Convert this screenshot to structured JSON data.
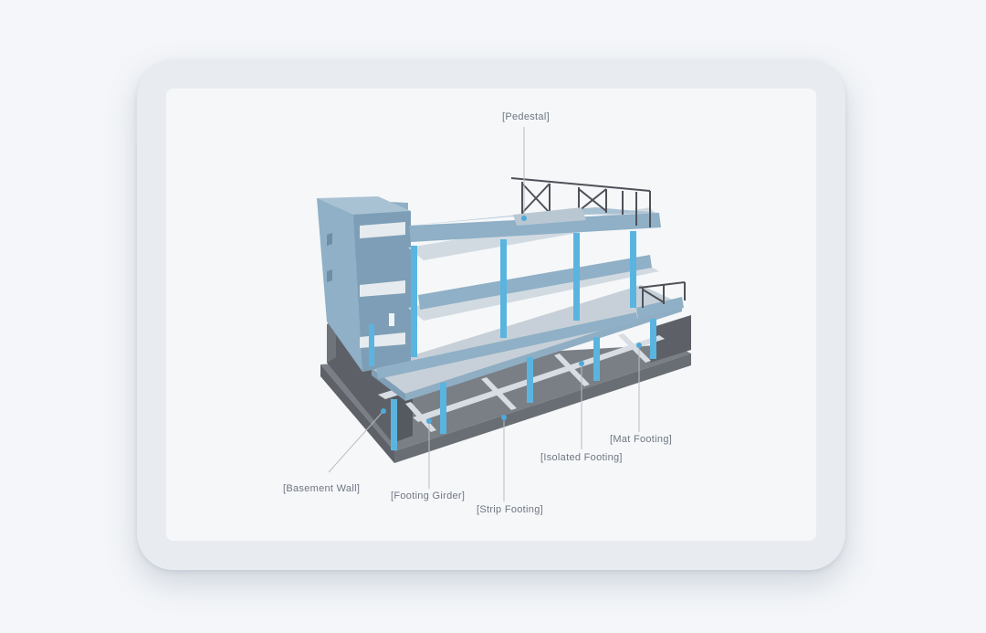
{
  "diagram": {
    "labels": {
      "pedestal": "[Pedestal]",
      "basement_wall": "[Basement Wall]",
      "footing_girder": "[Footing Girder]",
      "strip_footing": "[Strip Footing]",
      "isolated_footing": "[Isolated Footing]",
      "mat_footing": "[Mat Footing]"
    },
    "colors": {
      "concrete": "#8faec4",
      "column_highlight": "#5ab4e0",
      "slab_top": "#c9d3db",
      "foundation": "#6d7177",
      "steel": "#4e5258",
      "leader_line": "#b7bdc5"
    }
  }
}
